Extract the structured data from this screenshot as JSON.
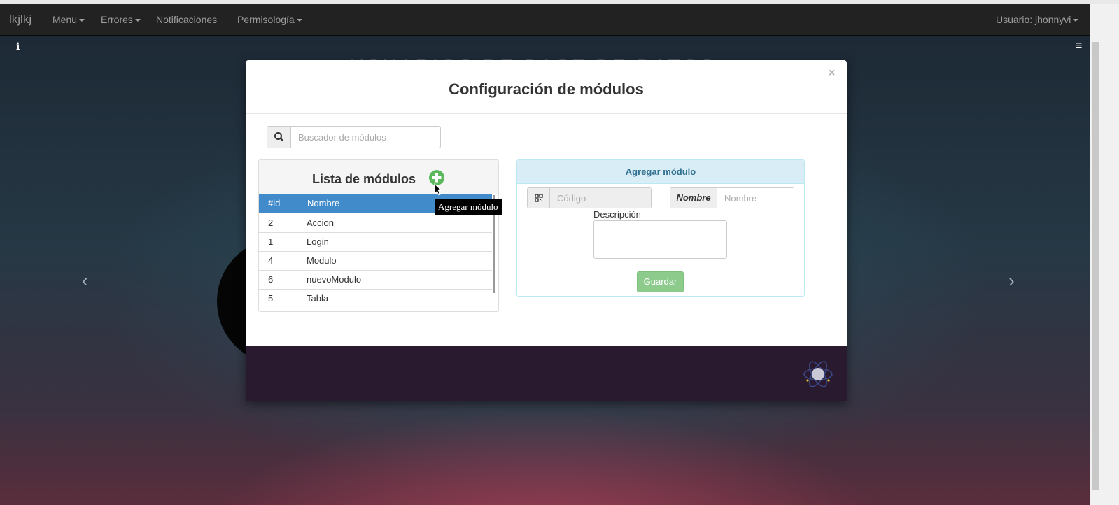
{
  "navbar": {
    "brand": "lkjlkj",
    "items": [
      {
        "label": "Menu",
        "dropdown": true
      },
      {
        "label": "Errores",
        "dropdown": true
      },
      {
        "label": "Notificaciones",
        "dropdown": false
      },
      {
        "label": "Permisología",
        "dropdown": true
      }
    ],
    "user": "Usuario: jhonnyvi"
  },
  "background": {
    "title": "USUARIOS DE BASE DE DATOS"
  },
  "modal": {
    "title": "Configuración de módulos",
    "close_label": "×",
    "search": {
      "placeholder": "Buscador de módulos",
      "value": ""
    },
    "list": {
      "title": "Lista de módulos",
      "add_tooltip": "Agregar módulo",
      "columns": [
        "#id",
        "Nombre"
      ],
      "rows": [
        {
          "id": "2",
          "name": "Accion"
        },
        {
          "id": "1",
          "name": "Login"
        },
        {
          "id": "4",
          "name": "Modulo"
        },
        {
          "id": "6",
          "name": "nuevoModulo"
        },
        {
          "id": "5",
          "name": "Tabla"
        }
      ]
    },
    "form": {
      "title": "Agregar módulo",
      "codigo_placeholder": "Código",
      "nombre_label": "Nombre",
      "nombre_placeholder": "Nombre",
      "descripcion_label": "Descripción",
      "save_label": "Guardar"
    }
  },
  "colors": {
    "navbar": "#222222",
    "table_header": "#428bca",
    "add_icon": "#5cb85c",
    "save_button": "#8ccb8c",
    "panel_info": "#d9edf7",
    "footer": "#2a1a30"
  }
}
